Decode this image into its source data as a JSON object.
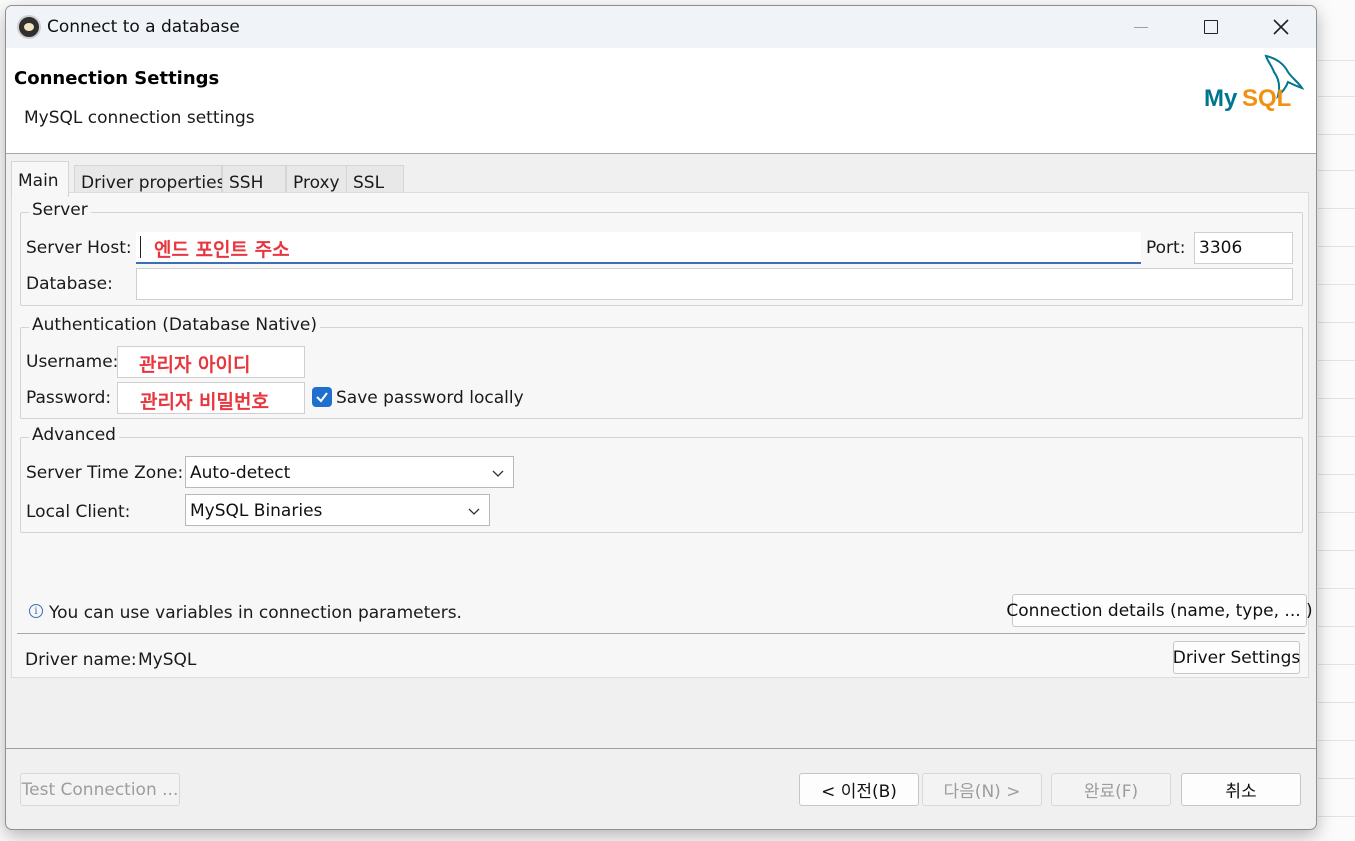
{
  "window": {
    "title": "Connect to a database"
  },
  "header": {
    "title": "Connection Settings",
    "subtitle": "MySQL connection settings",
    "logo_text": "MySQL"
  },
  "tabs": [
    {
      "label": "Main",
      "active": true
    },
    {
      "label": "Driver properties",
      "active": false
    },
    {
      "label": "SSH",
      "active": false
    },
    {
      "label": "Proxy",
      "active": false
    },
    {
      "label": "SSL",
      "active": false
    }
  ],
  "server": {
    "group_title": "Server",
    "host_label": "Server Host:",
    "host_annotation": "엔드 포인트 주소",
    "port_label": "Port:",
    "port_value": "3306",
    "database_label": "Database:",
    "database_value": ""
  },
  "auth": {
    "group_title": "Authentication (Database Native)",
    "username_label": "Username:",
    "username_annotation": "관리자 아이디",
    "password_label": "Password:",
    "password_annotation": "관리자 비밀번호",
    "save_password_label": "Save password locally",
    "save_password_checked": true
  },
  "advanced": {
    "group_title": "Advanced",
    "timezone_label": "Server Time Zone:",
    "timezone_value": "Auto-detect",
    "local_client_label": "Local Client:",
    "local_client_value": "MySQL Binaries"
  },
  "info": {
    "text": "You can use variables in connection parameters.",
    "connection_details_button": "Connection details (name, type, ... )"
  },
  "driver": {
    "label": "Driver name:",
    "name": "MySQL",
    "settings_button": "Driver Settings"
  },
  "footer": {
    "test_connection": "Test Connection ...",
    "back": "< 이전(B)",
    "next": "다음(N) >",
    "finish": "완료(F)",
    "cancel": "취소"
  },
  "colors": {
    "accent": "#1f6fd1",
    "annotation": "#e8363f",
    "mysql_blue": "#00758f",
    "mysql_orange": "#f29111"
  }
}
